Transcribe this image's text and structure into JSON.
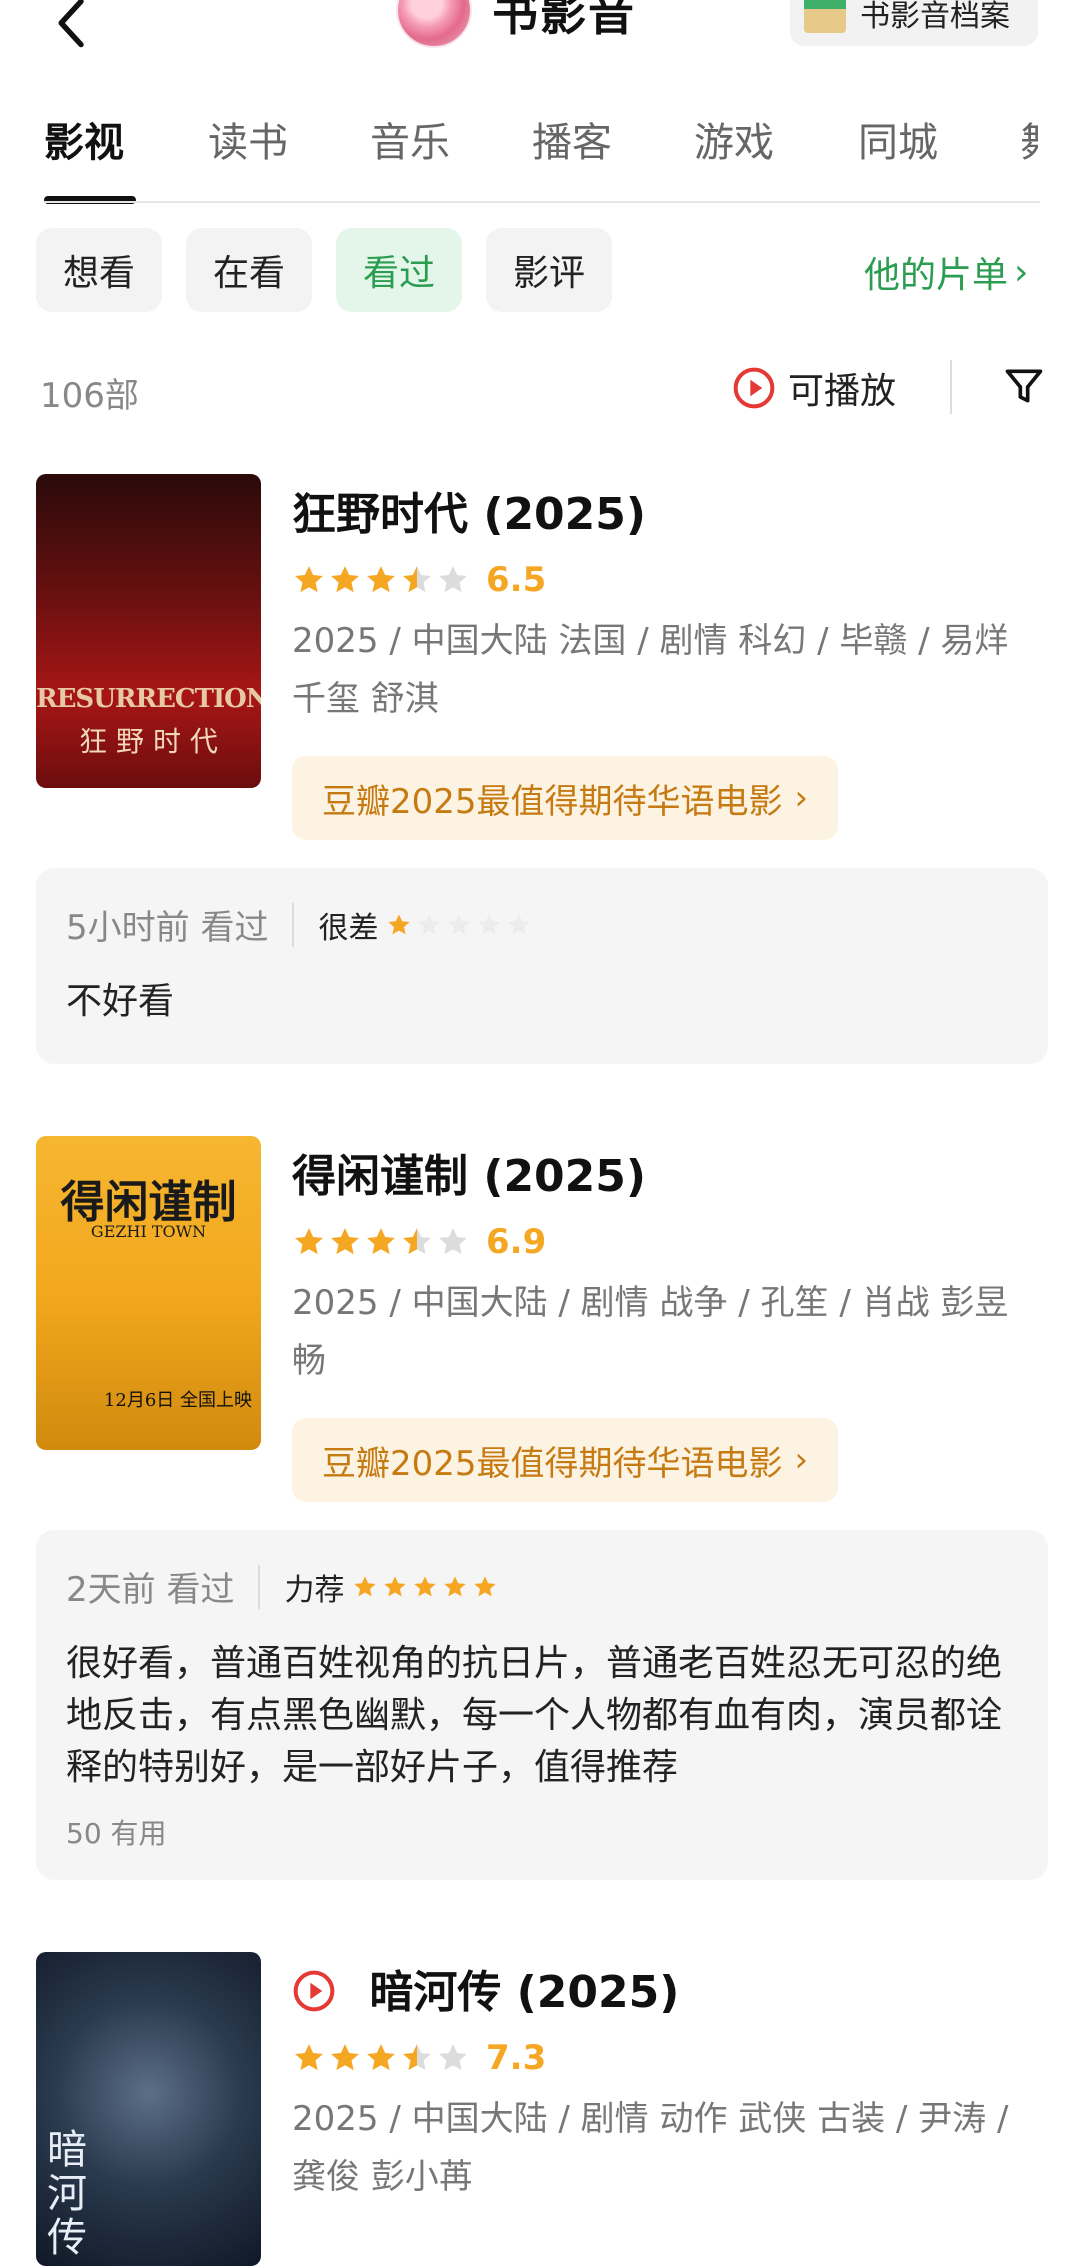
{
  "header": {
    "title": "书影音",
    "archive_label": "书影音档案"
  },
  "tabs": [
    "影视",
    "读书",
    "音乐",
    "播客",
    "游戏",
    "同城",
    "舞"
  ],
  "chips": [
    "想看",
    "在看",
    "看过",
    "影评"
  ],
  "his_list_label": "他的片单",
  "count_label": "106部",
  "playable_label": "可播放",
  "colors": {
    "accent_green": "#2a9d50",
    "star": "#f5a623",
    "badge_text": "#c67a12",
    "play_red": "#e53935"
  },
  "movies": [
    {
      "title": "狂野时代",
      "year": "(2025)",
      "stars_value": 3.5,
      "score": "6.5",
      "meta": "2025 / 中国大陆 法国 / 剧情 科幻 / 毕赣 / 易烊千玺 舒淇",
      "badge": "豆瓣2025最值得期待华语电影",
      "poster_text_1": "RESURRECTION",
      "poster_text_2": "狂 野 时 代",
      "review": {
        "time": "5小时前 看过",
        "level": "很差",
        "stars_value": 1,
        "text": "不好看"
      }
    },
    {
      "title": "得闲谨制",
      "year": "(2025)",
      "stars_value": 3.5,
      "score": "6.9",
      "meta": "2025 / 中国大陆 / 剧情 战争 / 孔笙 / 肖战 彭昱畅",
      "badge": "豆瓣2025最值得期待华语电影",
      "poster_text_1": "得闲谨制",
      "poster_text_2": "GEZHI TOWN",
      "poster_text_3": "12月6日 全国上映",
      "review": {
        "time": "2天前 看过",
        "level": "力荐",
        "stars_value": 5,
        "text": "很好看，普通百姓视角的抗日片，普通老百姓忍无可忍的绝地反击，有点黑色幽默，每一个人物都有血有肉，演员都诠释的特别好，是一部好片子，值得推荐",
        "useful": "50 有用"
      }
    },
    {
      "title": "暗河传",
      "year": "(2025)",
      "stars_value": 3.5,
      "score": "7.3",
      "meta": "2025 / 中国大陆 / 剧情 动作 武侠 古装 / 尹涛 / 龚俊 彭小苒",
      "poster_text_1": "暗河传"
    }
  ]
}
